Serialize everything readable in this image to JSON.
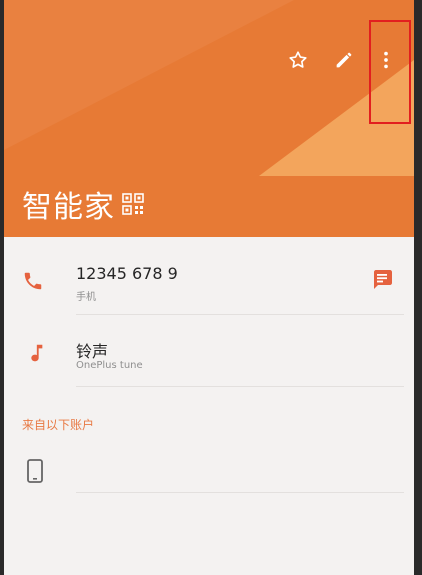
{
  "contact": {
    "name": "智能家"
  },
  "toolbar": {
    "favorite_icon": "star-outline-icon",
    "edit_icon": "pencil-icon",
    "more_icon": "more-vertical-icon"
  },
  "phone": {
    "number": "12345 678 9",
    "type": "手机"
  },
  "ringtone": {
    "label": "铃声",
    "value": "OnePlus tune"
  },
  "accounts": {
    "section_title": "来自以下账户"
  },
  "colors": {
    "header": "#e77a35",
    "accent": "#e5623f",
    "highlight": "#e21f1f"
  }
}
